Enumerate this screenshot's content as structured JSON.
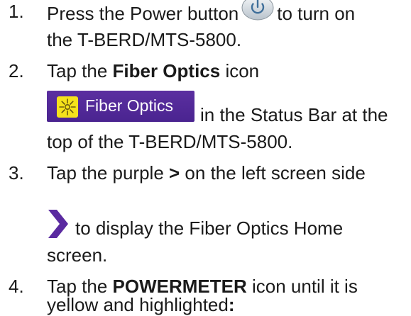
{
  "steps": [
    {
      "number": "1.",
      "line1_pre": "Press the Power button",
      "line1_post": "to turn on",
      "line2": "the T-BERD/MTS-5800."
    },
    {
      "number": "2.",
      "line1_pre": "Tap the ",
      "line1_bold": "Fiber Optics",
      "line1_post": " icon",
      "chip_label": "Fiber Optics",
      "line2_post": "in the Status Bar at the",
      "line3": "top of the T-BERD/MTS-5800."
    },
    {
      "number": "3.",
      "line1_pre": "Tap the purple ",
      "line1_bold": ">",
      "line1_post": " on the left screen side",
      "line2_post": "to display the Fiber Optics Home",
      "line3": "screen."
    },
    {
      "number": "4.",
      "line1_pre": "Tap the ",
      "line1_bold": "POWERMETER",
      "line1_post": " icon until it is",
      "line2_pre": "yellow and highlighted",
      "line2_bold": ":"
    }
  ],
  "icons": {
    "power": "power-icon",
    "fiber_optics": "fiber-optics-sun-icon",
    "chevron": "chevron-right-icon"
  },
  "colors": {
    "chip_background": "#4f2896",
    "chip_icon": "#f5e21b",
    "chevron": "#5a2aa0",
    "text": "#1a1a1a"
  }
}
